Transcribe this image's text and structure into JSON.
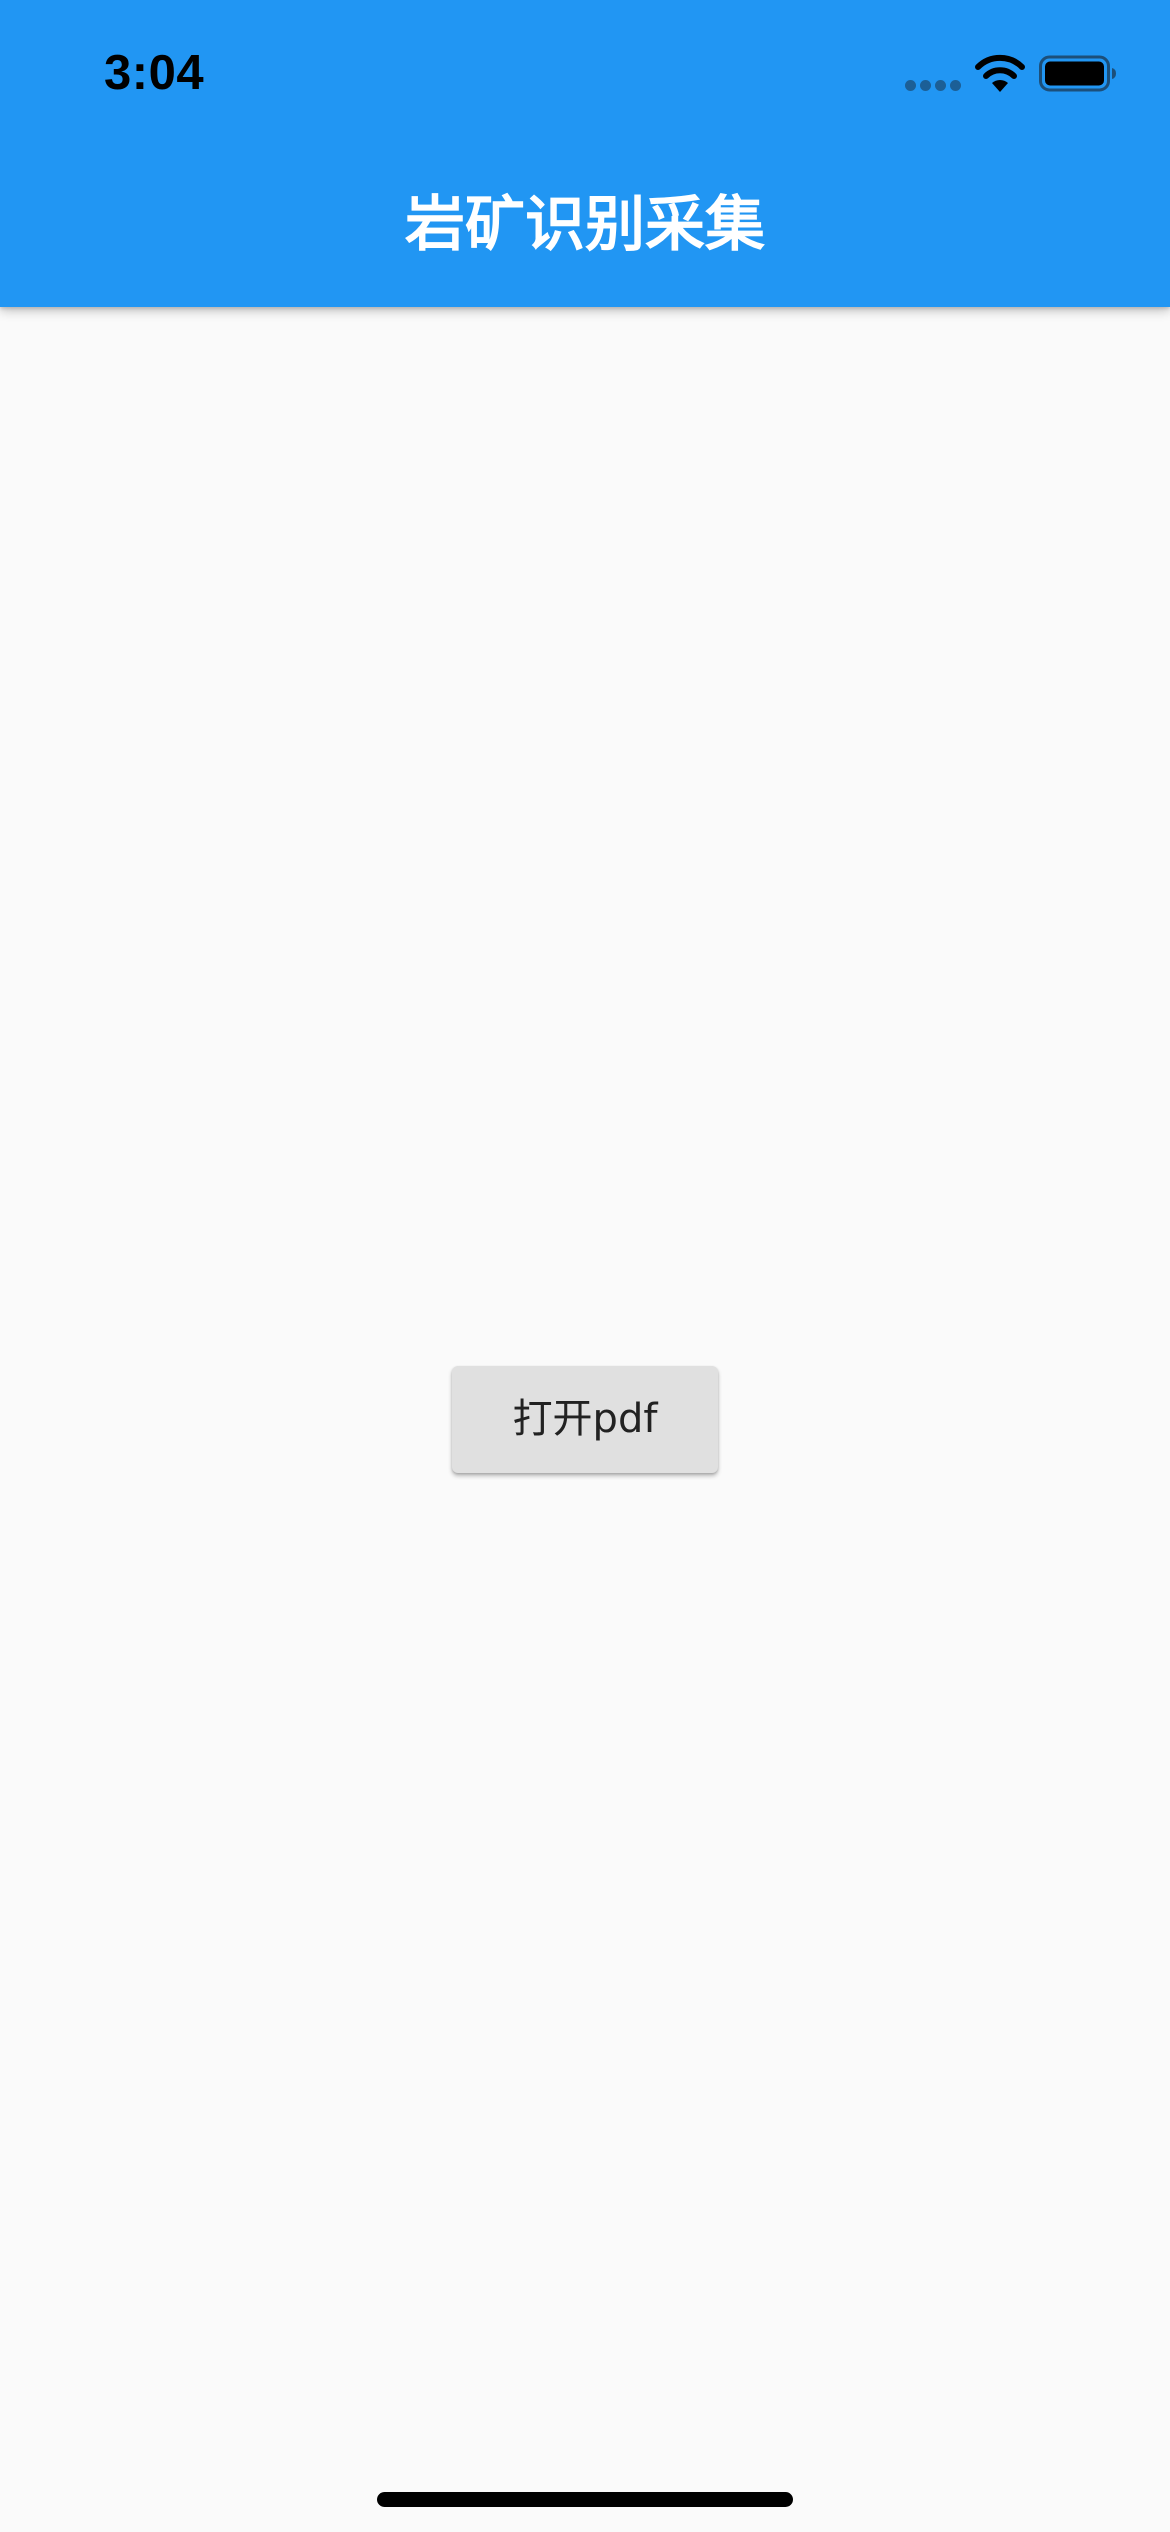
{
  "status_bar": {
    "time": "3:04"
  },
  "app_bar": {
    "title": "岩矿识别采集",
    "background_color": "#2196f3",
    "title_color": "#ffffff"
  },
  "main": {
    "open_pdf_button_label": "打开pdf",
    "background_color": "#fafafa"
  },
  "icons": {
    "signal": "cellular-signal-dots-icon",
    "wifi": "wifi-icon",
    "battery": "battery-icon"
  }
}
